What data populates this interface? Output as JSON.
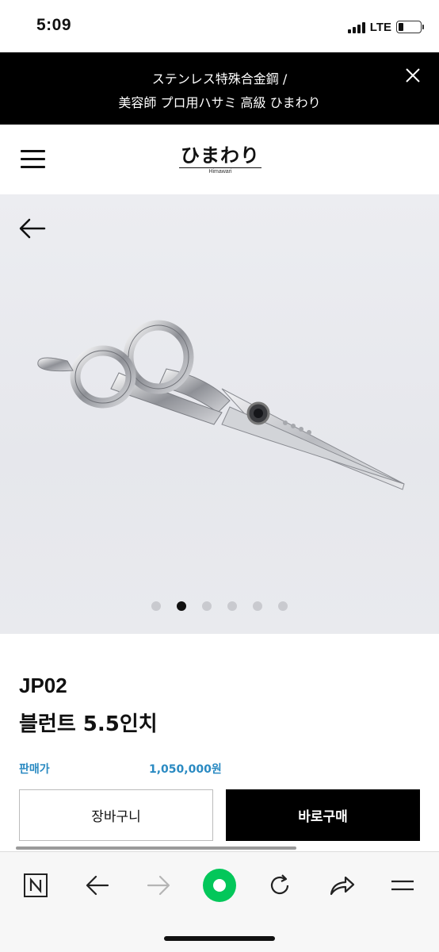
{
  "status_bar": {
    "time": "5:09",
    "network": "LTE",
    "battery_level": 0.22
  },
  "promo_banner": {
    "line1": "ステンレス特殊合金鋼 /",
    "line2": "美容師 プロ用ハサミ 高級 ひまわり",
    "close_icon": "close-icon"
  },
  "header": {
    "menu_icon": "hamburger-menu-icon",
    "logo_text": "ひまわり",
    "logo_subtext": "Himawari"
  },
  "gallery": {
    "back_icon": "arrow-left-icon",
    "image_subject": "scissors",
    "total_slides": 6,
    "active_slide": 2
  },
  "product": {
    "code": "JP02",
    "name": "블런트 5.5인치",
    "price_label": "판매가",
    "price_value": "1,050,000원"
  },
  "actions": {
    "cart_label": "장바구니",
    "buy_label": "바로구매"
  },
  "browser_toolbar": {
    "icons": [
      "naver-n-icon",
      "back-arrow-icon",
      "forward-arrow-icon",
      "home-circle-icon",
      "refresh-icon",
      "share-icon",
      "menu-lines-icon"
    ]
  },
  "colors": {
    "accent_price": "#2a8ac2",
    "banner_bg": "#000000",
    "home_button_green": "#03c75a"
  }
}
